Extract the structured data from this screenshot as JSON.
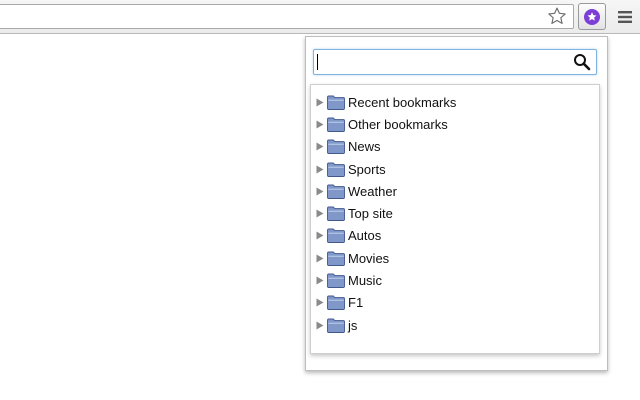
{
  "toolbar": {
    "star_icon": "star-icon",
    "extension_icon": "bookmark-extension-icon",
    "menu_icon": "hamburger-menu-icon",
    "extension_color": "#7b3fd6"
  },
  "popup": {
    "search": {
      "value": "",
      "placeholder": "",
      "icon": "search-icon"
    },
    "bookmarks": [
      {
        "label": "Recent bookmarks",
        "icon": "folder-icon",
        "expander": "collapsed"
      },
      {
        "label": "Other bookmarks",
        "icon": "folder-icon",
        "expander": "collapsed"
      },
      {
        "label": "News",
        "icon": "folder-icon",
        "expander": "collapsed"
      },
      {
        "label": "Sports",
        "icon": "folder-icon",
        "expander": "collapsed"
      },
      {
        "label": "Weather",
        "icon": "folder-icon",
        "expander": "collapsed"
      },
      {
        "label": "Top site",
        "icon": "folder-icon",
        "expander": "collapsed"
      },
      {
        "label": "Autos",
        "icon": "folder-icon",
        "expander": "collapsed"
      },
      {
        "label": "Movies",
        "icon": "folder-icon",
        "expander": "collapsed"
      },
      {
        "label": "Music",
        "icon": "folder-icon",
        "expander": "collapsed"
      },
      {
        "label": "F1",
        "icon": "folder-icon",
        "expander": "collapsed"
      },
      {
        "label": "js",
        "icon": "folder-icon",
        "expander": "collapsed"
      }
    ],
    "folder_color": "#7f97c9"
  }
}
